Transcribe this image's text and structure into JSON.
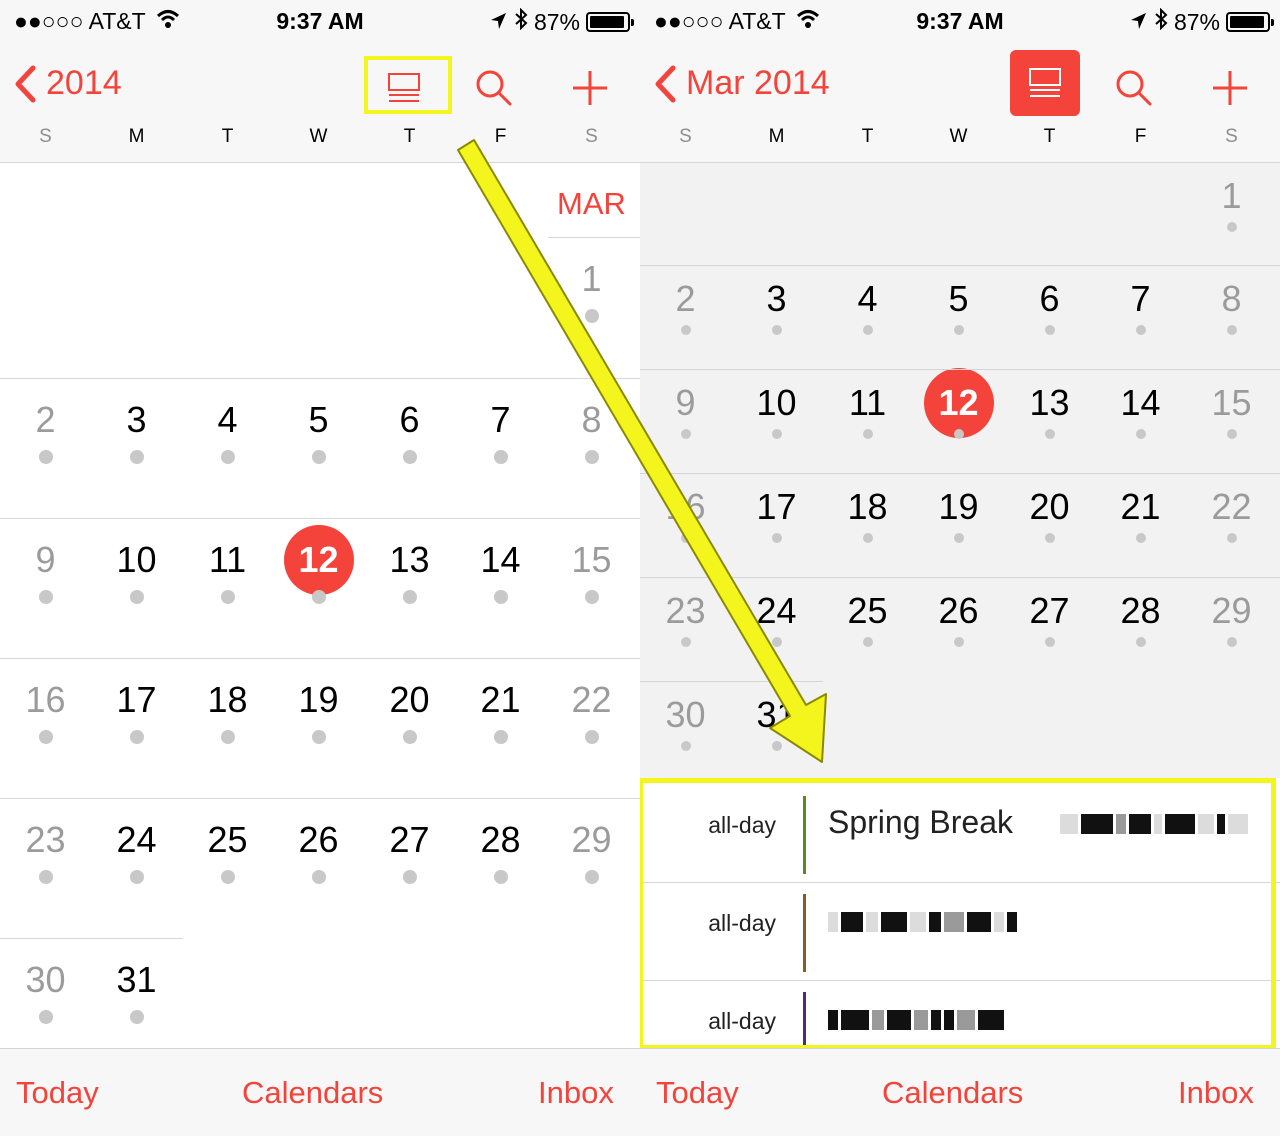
{
  "status": {
    "carrier": "●●○○○ AT&T",
    "time": "9:37 AM",
    "battery": "87%"
  },
  "weekdays": [
    "S",
    "M",
    "T",
    "W",
    "T",
    "F",
    "S"
  ],
  "left": {
    "back_label": "2014",
    "month_label": "MAR",
    "weeks": [
      [
        "",
        "",
        "",
        "",
        "",
        "",
        "1"
      ],
      [
        "2",
        "3",
        "4",
        "5",
        "6",
        "7",
        "8"
      ],
      [
        "9",
        "10",
        "11",
        "12",
        "13",
        "14",
        "15"
      ],
      [
        "16",
        "17",
        "18",
        "19",
        "20",
        "21",
        "22"
      ],
      [
        "23",
        "24",
        "25",
        "26",
        "27",
        "28",
        "29"
      ],
      [
        "30",
        "31",
        "",
        "",
        "",
        "",
        ""
      ]
    ],
    "today": "12"
  },
  "right": {
    "back_label": "Mar 2014",
    "weeks": [
      [
        "",
        "",
        "",
        "",
        "",
        "",
        "1"
      ],
      [
        "2",
        "3",
        "4",
        "5",
        "6",
        "7",
        "8"
      ],
      [
        "9",
        "10",
        "11",
        "12",
        "13",
        "14",
        "15"
      ],
      [
        "16",
        "17",
        "18",
        "19",
        "20",
        "21",
        "22"
      ],
      [
        "23",
        "24",
        "25",
        "26",
        "27",
        "28",
        "29"
      ],
      [
        "30",
        "31",
        "",
        "",
        "",
        "",
        ""
      ]
    ],
    "today": "12",
    "events": [
      {
        "allday": "all-day",
        "title": "Spring Break",
        "color": "#5a8a1e"
      },
      {
        "allday": "all-day",
        "title": "",
        "color": "#8a5a1e"
      },
      {
        "allday": "all-day",
        "title": "",
        "color": "#4b2e7a"
      }
    ]
  },
  "tabs": {
    "today": "Today",
    "calendars": "Calendars",
    "inbox": "Inbox"
  },
  "colors": {
    "accent": "#f4433a",
    "highlight": "#f5f51e"
  },
  "icons": [
    "signal-icon",
    "wifi-icon",
    "location-icon",
    "bluetooth-icon",
    "battery-icon",
    "chevron-left-icon",
    "list-view-icon",
    "search-icon",
    "plus-icon",
    "arrow-icon"
  ]
}
